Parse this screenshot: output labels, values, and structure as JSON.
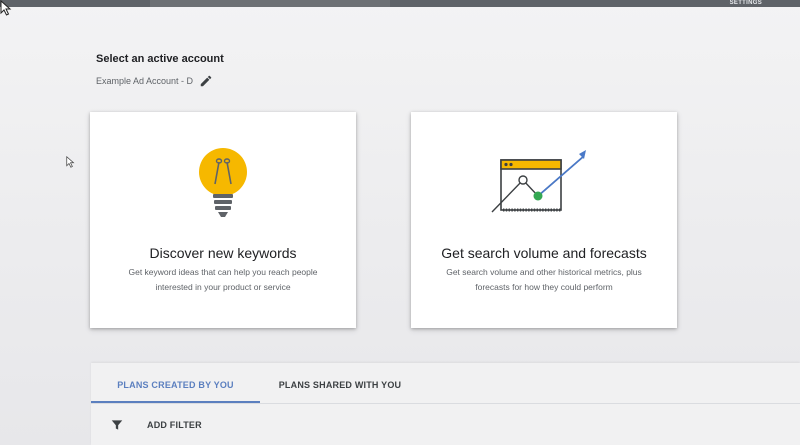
{
  "topbar": {
    "settings_label": "SETTINGS"
  },
  "account": {
    "title": "Select an active account",
    "name": "Example Ad Account - D",
    "edit_icon": "pencil-icon"
  },
  "cards": [
    {
      "title": "Discover new keywords",
      "description": "Get keyword ideas that can help you reach people interested in your product or service",
      "icon": "lightbulb-icon"
    },
    {
      "title": "Get search volume and forecasts",
      "description": "Get search volume and other historical metrics, plus forecasts for how they could perform",
      "icon": "forecast-chart-icon"
    }
  ],
  "plans": {
    "tabs": [
      {
        "label": "PLANS CREATED BY YOU",
        "active": true
      },
      {
        "label": "PLANS SHARED WITH YOU",
        "active": false
      }
    ],
    "filter_label": "ADD FILTER",
    "filter_icon": "filter-icon"
  },
  "colors": {
    "accent": "#5b7fbf",
    "bulb_yellow": "#f6b800",
    "chart_blue": "#4a79c8",
    "chart_green": "#34a853"
  }
}
